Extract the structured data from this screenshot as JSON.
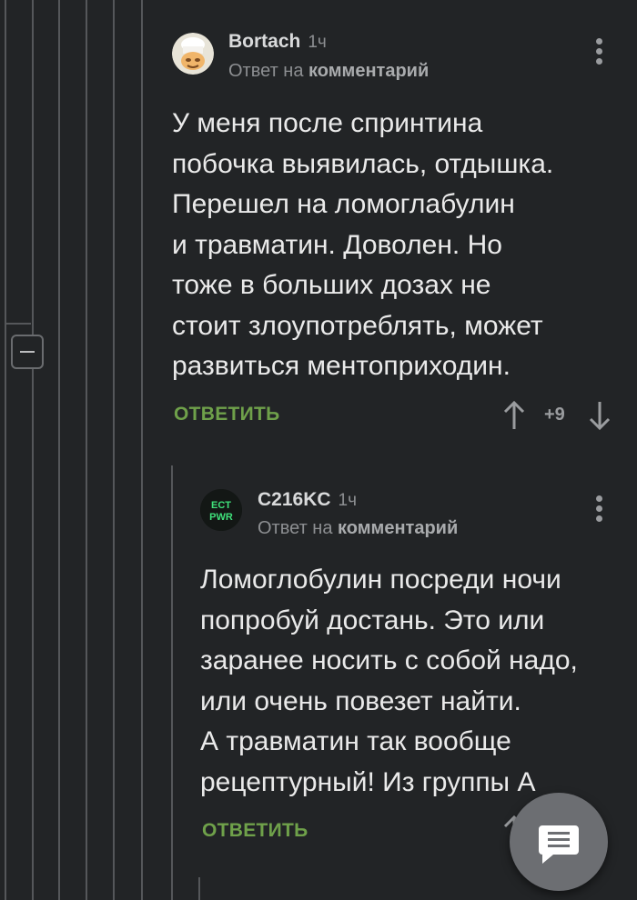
{
  "comments": [
    {
      "author": "Bortach",
      "time": "1ч",
      "reply_prefix": "Ответ на",
      "reply_target": "комментарий",
      "lines": [
        "У меня после спринтина",
        "побочка выявилась, отдышка.",
        "Перешел на ломоглабулин",
        "и травматин. Доволен. Но",
        "тоже в больших дозах не",
        "стоит злоупотреблять, может",
        "развиться ментоприходин."
      ],
      "reply_label": "ОТВЕТИТЬ",
      "rating": "+9",
      "avatar_icon": "chef-avatar-icon"
    },
    {
      "author": "C216KC",
      "time": "1ч",
      "reply_prefix": "Ответ на",
      "reply_target": "комментарий",
      "lines": [
        "Ломоглобулин посреди ночи",
        "попробуй достань. Это или",
        "заранее носить с собой надо,",
        "или очень повезет найти.",
        "А травматин так вообще",
        "рецептурный! Из группы А"
      ],
      "reply_label": "ОТВЕТИТЬ",
      "avatar_text": "ECT PWR"
    }
  ],
  "colors": {
    "background": "#222426",
    "reply_button": "#6fa14a",
    "thread_line": "#55575a",
    "fab": "#6c6e72"
  }
}
